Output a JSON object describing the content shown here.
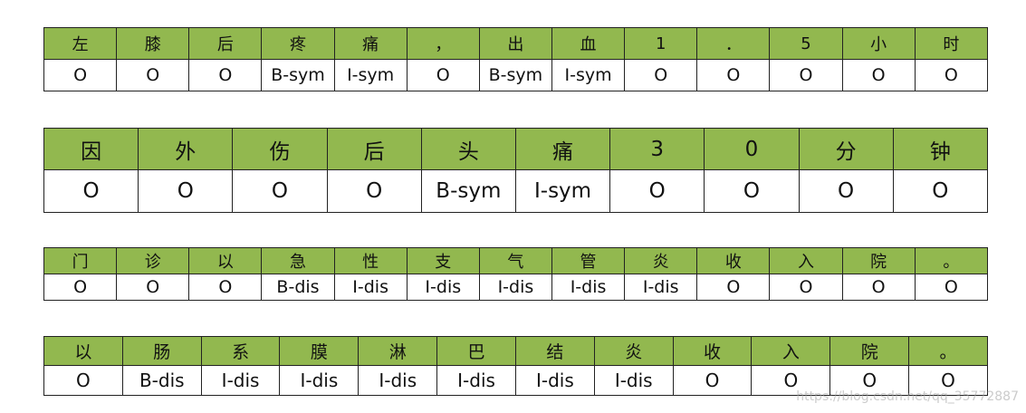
{
  "tables": [
    {
      "chars": [
        "左",
        "膝",
        "后",
        "疼",
        "痛",
        "，",
        "出",
        "血",
        "1",
        "．",
        "5",
        "小",
        "时"
      ],
      "tags": [
        "O",
        "O",
        "O",
        "B-sym",
        "I-sym",
        "O",
        "B-sym",
        "I-sym",
        "O",
        "O",
        "O",
        "O",
        "O"
      ]
    },
    {
      "chars": [
        "因",
        "外",
        "伤",
        "后",
        "头",
        "痛",
        "3",
        "0",
        "分",
        "钟"
      ],
      "tags": [
        "O",
        "O",
        "O",
        "O",
        "B-sym",
        "I-sym",
        "O",
        "O",
        "O",
        "O"
      ]
    },
    {
      "chars": [
        "门",
        "诊",
        "以",
        "急",
        "性",
        "支",
        "气",
        "管",
        "炎",
        "收",
        "入",
        "院",
        "。"
      ],
      "tags": [
        "O",
        "O",
        "O",
        "B-dis",
        "I-dis",
        "I-dis",
        "I-dis",
        "I-dis",
        "I-dis",
        "O",
        "O",
        "O",
        "O"
      ]
    },
    {
      "chars": [
        "以",
        "肠",
        "系",
        "膜",
        "淋",
        "巴",
        "结",
        "炎",
        "收",
        "入",
        "院",
        "。"
      ],
      "tags": [
        "O",
        "B-dis",
        "I-dis",
        "I-dis",
        "I-dis",
        "I-dis",
        "I-dis",
        "I-dis",
        "O",
        "O",
        "O",
        "O"
      ]
    }
  ],
  "watermark": "https://blog.csdn.net/qq_35772887",
  "colors": {
    "header_bg": "#92b84f",
    "cell_bg": "#ffffff",
    "border": "#222222"
  }
}
